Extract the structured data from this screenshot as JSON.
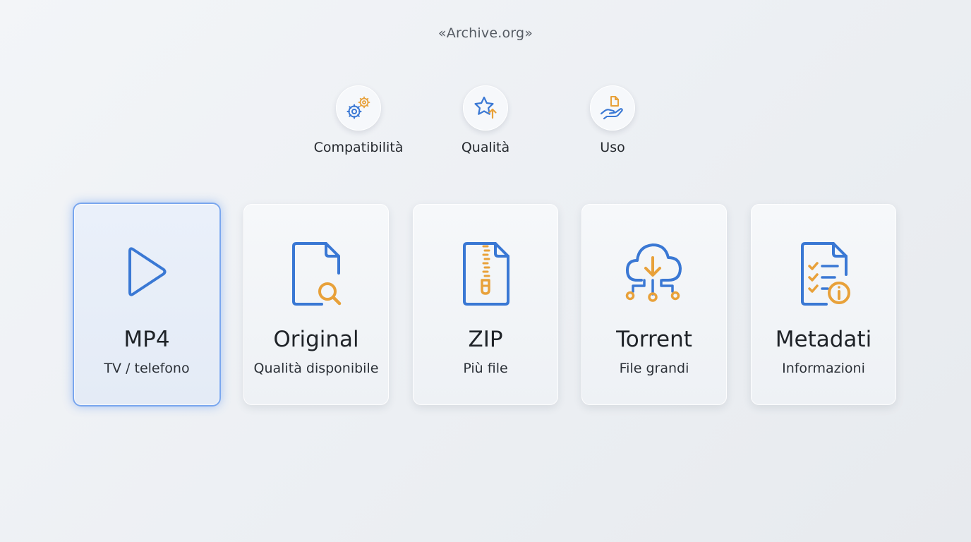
{
  "header": {
    "source_label": "«Archive.org»"
  },
  "criteria": [
    {
      "label": "Compatibilità",
      "icon": "gears-icon"
    },
    {
      "label": "Qualità",
      "icon": "star-up-icon"
    },
    {
      "label": "Uso",
      "icon": "hand-file-icon"
    }
  ],
  "cards": [
    {
      "title": "MP4",
      "subtitle": "TV / telefono",
      "icon": "play-icon",
      "selected": true
    },
    {
      "title": "Original",
      "subtitle": "Qualità disponibile",
      "icon": "file-search-icon",
      "selected": false
    },
    {
      "title": "ZIP",
      "subtitle": "Più file",
      "icon": "zip-file-icon",
      "selected": false
    },
    {
      "title": "Torrent",
      "subtitle": "File grandi",
      "icon": "cloud-download-icon",
      "selected": false
    },
    {
      "title": "Metadati",
      "subtitle": "Informazioni",
      "icon": "info-document-icon",
      "selected": false
    }
  ],
  "colors": {
    "icon_blue": "#3a78d4",
    "icon_orange": "#e8a13a",
    "selected_border": "#79a6ee"
  }
}
